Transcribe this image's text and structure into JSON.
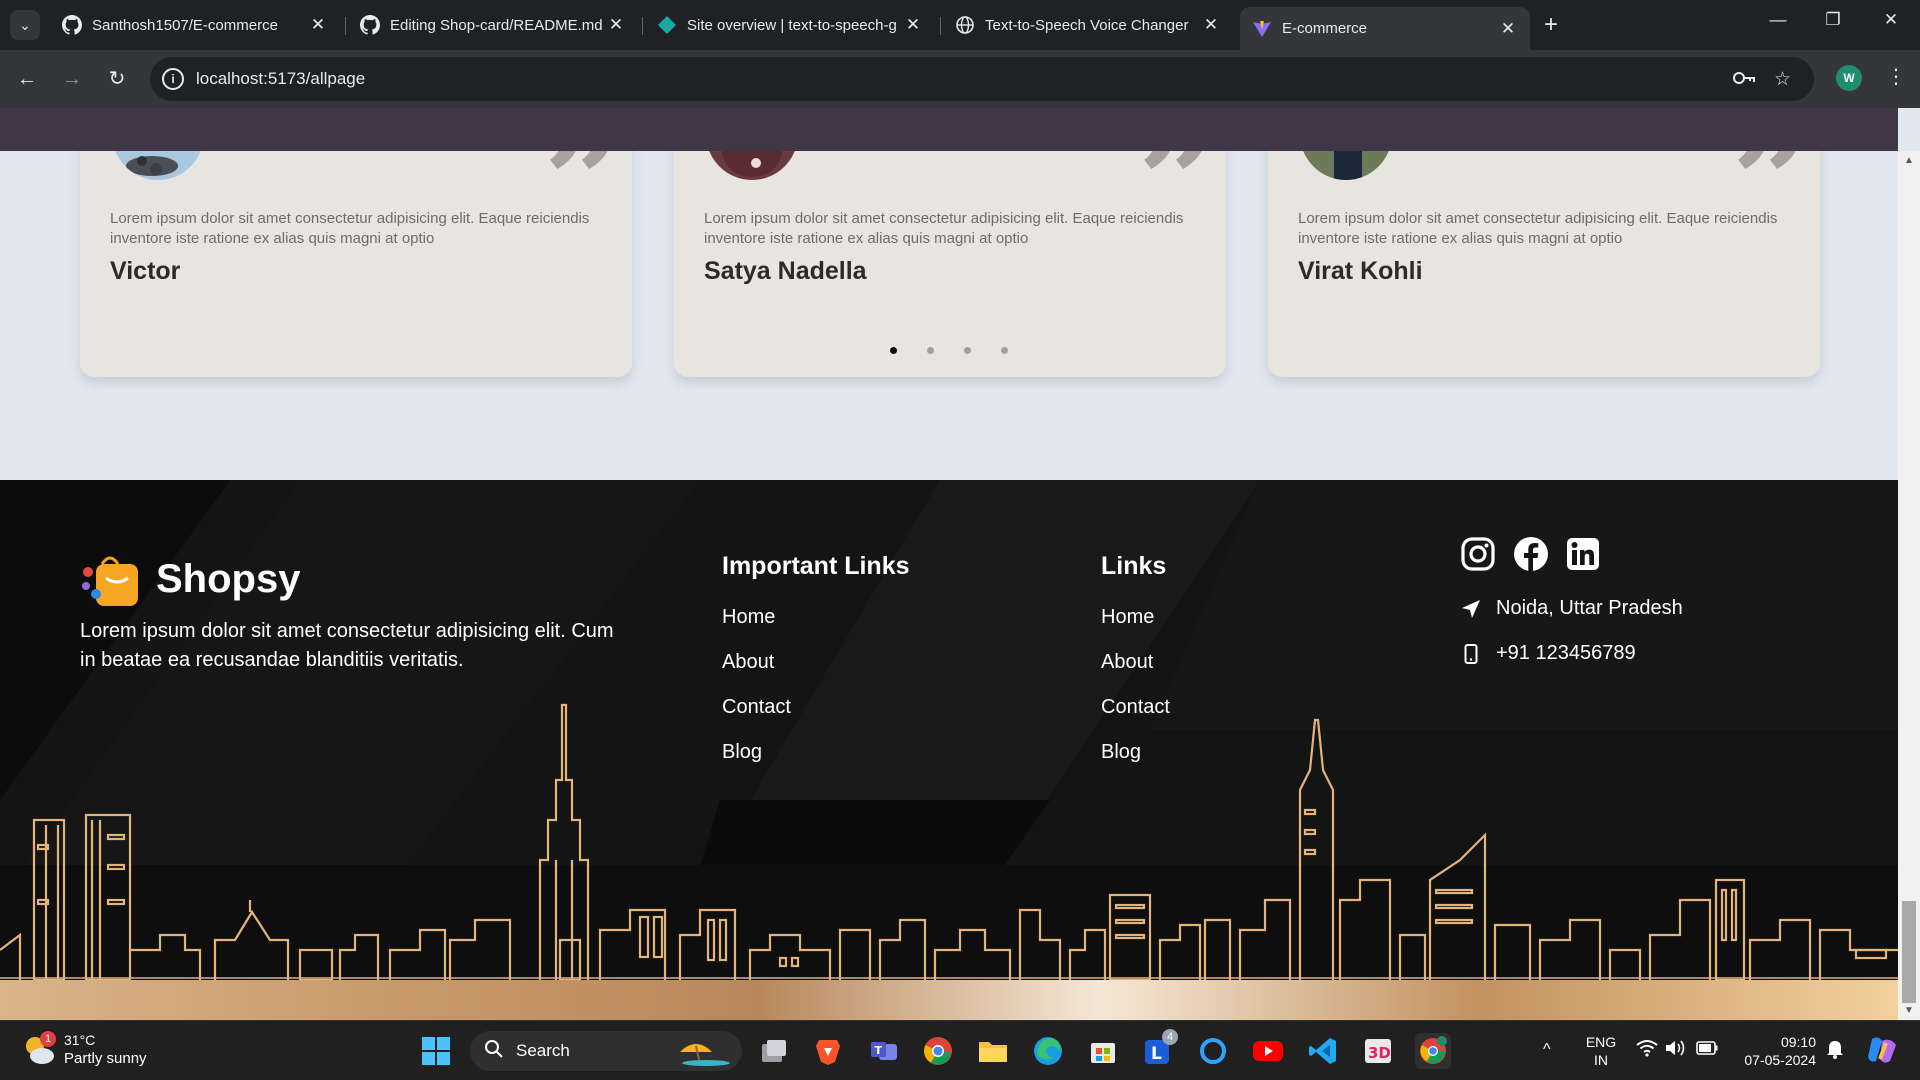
{
  "browser": {
    "tabs": [
      {
        "title": "Santhosh1507/E-commerce",
        "icon": "github-icon",
        "active": false
      },
      {
        "title": "Editing Shop-card/README.md",
        "icon": "github-icon",
        "active": false
      },
      {
        "title": "Site overview | text-to-speech-g",
        "icon": "netlify-icon",
        "active": false
      },
      {
        "title": "Text-to-Speech Voice Changer",
        "icon": "globe-icon",
        "active": false
      },
      {
        "title": "E-commerce",
        "icon": "vite-icon",
        "active": true
      }
    ],
    "new_tab": "+",
    "url": "localhost:5173/allpage",
    "profile_initial": "W"
  },
  "testimonials": [
    {
      "text": "Lorem ipsum dolor sit amet consectetur adipisicing elit. Eaque reiciendis inventore iste ratione ex alias quis magni at optio",
      "name": "Victor"
    },
    {
      "text": "Lorem ipsum dolor sit amet consectetur adipisicing elit. Eaque reiciendis inventore iste ratione ex alias quis magni at optio",
      "name": "Satya Nadella"
    },
    {
      "text": "Lorem ipsum dolor sit amet consectetur adipisicing elit. Eaque reiciendis inventore iste ratione ex alias quis magni at optio",
      "name": "Virat Kohli"
    }
  ],
  "carousel": {
    "count": 4,
    "active_index": 0
  },
  "footer": {
    "brand": "Shopsy",
    "description": "Lorem ipsum dolor sit amet consectetur adipisicing elit. Cum in beatae ea recusandae blanditiis veritatis.",
    "important_links": {
      "title": "Important Links",
      "items": [
        "Home",
        "About",
        "Contact",
        "Blog"
      ]
    },
    "links": {
      "title": "Links",
      "items": [
        "Home",
        "About",
        "Contact",
        "Blog"
      ]
    },
    "social": [
      "instagram-icon",
      "facebook-icon",
      "linkedin-icon"
    ],
    "location": "Noida, Uttar Pradesh",
    "phone": "+91 123456789",
    "skyline_color": "#e3b47c"
  },
  "taskbar": {
    "weather_temp": "31°C",
    "weather_cond": "Partly sunny",
    "weather_badge": "1",
    "search_label": "Search",
    "lens_badge": "4",
    "language_line1": "ENG",
    "language_line2": "IN",
    "time": "09:10",
    "date": "07-05-2024"
  }
}
